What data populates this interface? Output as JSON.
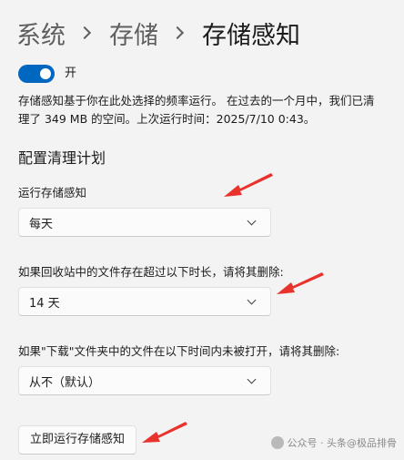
{
  "breadcrumb": {
    "items": [
      "系统",
      "存储"
    ],
    "current": "存储感知"
  },
  "toggle": {
    "state": "on",
    "label": "开",
    "color": "#0067c0"
  },
  "description": {
    "line1": "存储感知基于你在此处选择的频率运行。 在过去的一个月中，我们已清",
    "line2": "理了 349 MB 的空间。上次运行时间：2025/7/10 0:43。"
  },
  "schedule": {
    "title": "配置清理计划",
    "run_frequency": {
      "label": "运行存储感知",
      "value": "每天"
    },
    "recycle_bin": {
      "label": "如果回收站中的文件存在超过以下时长，请将其删除:",
      "value": "14 天"
    },
    "downloads": {
      "label": "如果\"下载\"文件夹中的文件在以下时间内未被打开，请将其删除:",
      "value": "从不（默认）"
    }
  },
  "actions": {
    "run_now_label": "立即运行存储感知"
  },
  "watermark": {
    "text": "公众号 · 头条@极品排骨"
  },
  "annotation_color": "#e8322b"
}
